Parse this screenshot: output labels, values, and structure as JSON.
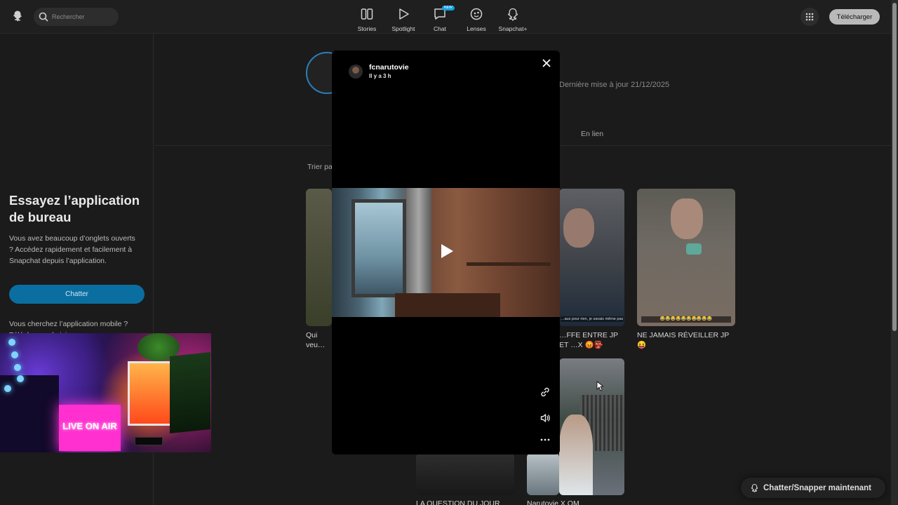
{
  "topbar": {
    "search_placeholder": "Rechercher",
    "nav": [
      {
        "label": "Stories",
        "icon": "stories-icon"
      },
      {
        "label": "Spotlight",
        "icon": "spotlight-play-icon"
      },
      {
        "label": "Chat",
        "icon": "chat-icon",
        "badge": "NEW"
      },
      {
        "label": "Lenses",
        "icon": "lenses-icon"
      },
      {
        "label": "Snapchat+",
        "icon": "snapchat-plus-icon"
      }
    ],
    "download_label": "Télécharger"
  },
  "sidebar": {
    "promo_title": "Essayez l’application de bureau",
    "promo_text": "Vous avez beaucoup d’onglets ouverts ? Accédez rapidement et facilement à Snapchat depuis l’application.",
    "chat_button": "Chatter",
    "mobile_text": "Vous cherchez l’application mobile ? Téléchargez-la ici"
  },
  "webcam": {
    "sign_text": "LIVE ON AIR"
  },
  "profile": {
    "updated": "Dernière mise à jour 21/12/2025",
    "tab_linked": "En lien",
    "sort_label": "Trier par"
  },
  "cards": [
    {
      "title": "Qui veu… vieux fil…"
    },
    {
      "title": "…FFE ENTRE JP ET …X 😡👺",
      "caption": "…aus pour rien, je savais même pas !"
    },
    {
      "title": "NE JAMAIS RÉVEILLER JP 😝",
      "caption": "😂😂😂😂😂😂😂😂😂😂"
    },
    {
      "title": "LA QUESTION DU JOUR"
    },
    {
      "title": "Narutovie X OM"
    }
  ],
  "modal": {
    "username": "fcnarutovie",
    "time": "Il y a 3 h"
  },
  "cta": {
    "label": "Chatter/Snapper maintenant"
  },
  "colors": {
    "accent": "#0fa1e0",
    "chat_button": "#0b6ea0",
    "download_button": "#b9b9b9"
  }
}
